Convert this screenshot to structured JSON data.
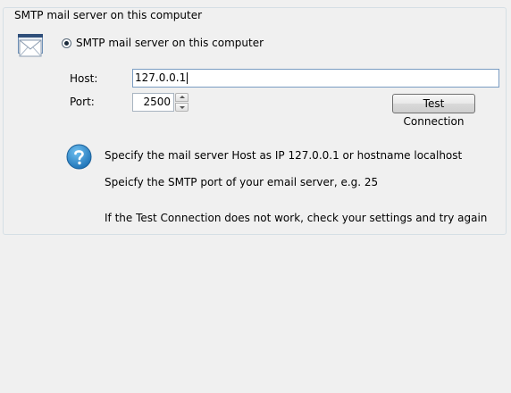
{
  "group": {
    "title": "SMTP mail server on this computer"
  },
  "radio": {
    "label": "SMTP mail server on this computer",
    "selected": true
  },
  "host": {
    "label": "Host:",
    "value": "127.0.0.1"
  },
  "port": {
    "label": "Port:",
    "value": "2500"
  },
  "test_button": {
    "label": "Test Connection"
  },
  "info": {
    "icon": "question-icon",
    "line1": "Specify the mail server Host as IP 127.0.0.1 or hostname localhost",
    "line2": "Speicfy the SMTP port of your email server, e.g. 25",
    "line3": "If the Test Connection does not work, check your settings and try again"
  },
  "icons": {
    "mail": "mail-icon",
    "help": "question-icon",
    "spin_up": "spin-up-icon",
    "spin_down": "spin-down-icon"
  },
  "colors": {
    "background": "#f0f0f0",
    "help_icon": "#2a86c8",
    "input_focus_border": "#7a9cc2"
  }
}
